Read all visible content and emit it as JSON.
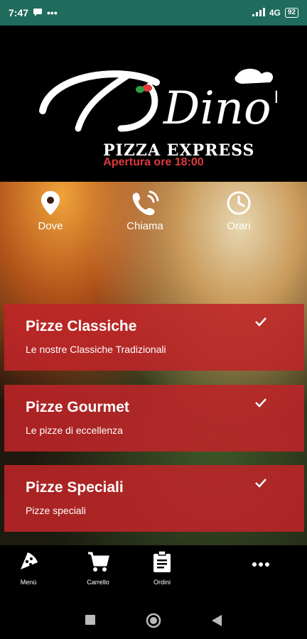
{
  "status_bar": {
    "time": "7:47",
    "network": "4G",
    "battery": "92"
  },
  "header": {
    "logo_script": "Dino's",
    "logo_sub": "PIZZA EXPRESS",
    "opening": "Apertura ore 18:00"
  },
  "shortcuts": [
    {
      "label": "Dove",
      "icon": "location-pin-icon"
    },
    {
      "label": "Chiama",
      "icon": "phone-ringing-icon"
    },
    {
      "label": "Orari",
      "icon": "clock-icon"
    }
  ],
  "categories": [
    {
      "title": "Pizze Classiche",
      "subtitle": "Le nostre Classiche Tradizionali"
    },
    {
      "title": "Pizze Gourmet",
      "subtitle": "Le pizze di eccellenza"
    },
    {
      "title": "Pizze Speciali",
      "subtitle": "Pizze speciali"
    }
  ],
  "bottom_nav": [
    {
      "label": "Menù",
      "icon": "pizza-slice-icon"
    },
    {
      "label": "Carrello",
      "icon": "cart-icon"
    },
    {
      "label": "Ordini",
      "icon": "clipboard-icon"
    },
    {
      "label": "",
      "icon": "more-dots-icon"
    }
  ],
  "colors": {
    "status_bar": "#1f6b5c",
    "accent_red": "#e0393e",
    "card_red": "#be2428"
  }
}
